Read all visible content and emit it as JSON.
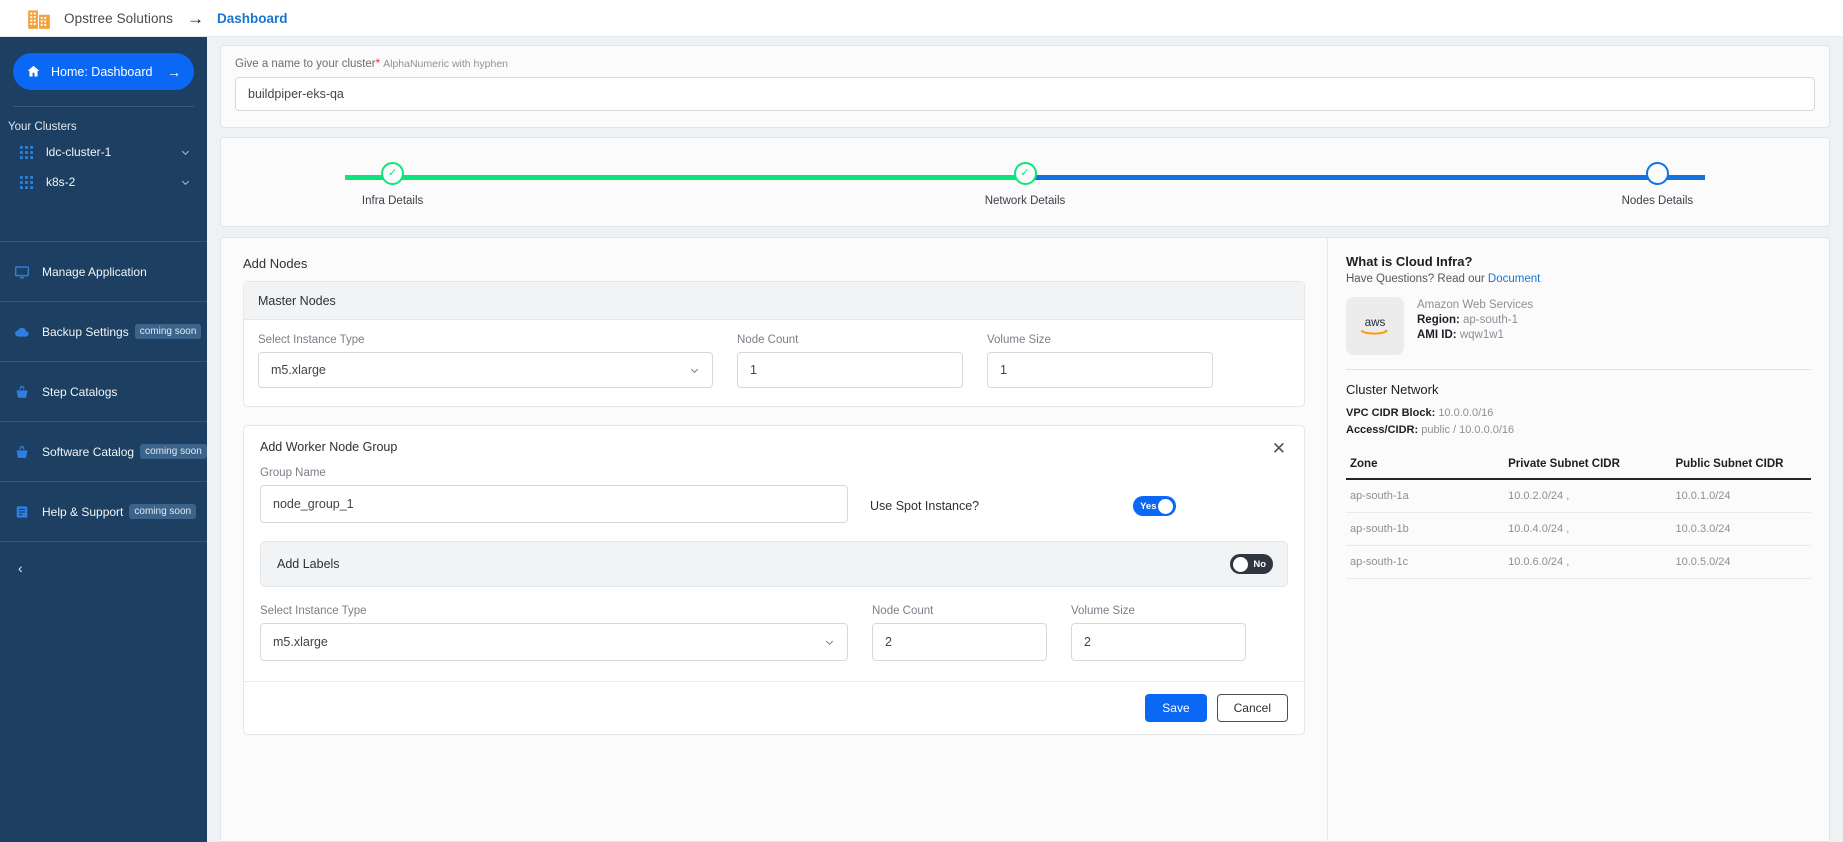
{
  "topbar": {
    "brand": "Opstree Solutions",
    "arrow": "→",
    "breadcrumb": "Dashboard"
  },
  "sidebar": {
    "home": {
      "label": "Home: Dashboard",
      "arrow": "→"
    },
    "clusters_title": "Your Clusters",
    "clusters": [
      {
        "label": "ldc-cluster-1"
      },
      {
        "label": "k8s-2"
      }
    ],
    "nav": [
      {
        "label": "Manage Application",
        "badge": "",
        "icon": "monitor-icon"
      },
      {
        "label": "Backup Settings",
        "badge": "coming soon",
        "icon": "cloud-upload-icon"
      },
      {
        "label": "Step Catalogs",
        "badge": "",
        "icon": "basket-icon"
      },
      {
        "label": "Software Catalog",
        "badge": "coming soon",
        "icon": "basket-icon"
      },
      {
        "label": "Help & Support",
        "badge": "coming soon",
        "icon": "book-icon"
      }
    ],
    "collapse": "‹"
  },
  "cluster_name": {
    "label": "Give a name to your cluster",
    "required_mark": "*",
    "hint": "AlphaNumeric with hyphen",
    "value": "buildpiper-eks-qa",
    "placeholder": "Enter cluster name"
  },
  "stepper": {
    "steps": [
      {
        "label": "Infra Details",
        "state": "done",
        "glyph": "✓"
      },
      {
        "label": "Network Details",
        "state": "done",
        "glyph": "✓"
      },
      {
        "label": "Nodes Details",
        "state": "active",
        "glyph": ""
      }
    ],
    "colors": {
      "done": "#0ae67c",
      "active": "#1273e0"
    }
  },
  "add_nodes": {
    "title": "Add Nodes",
    "master": {
      "panel_title": "Master Nodes",
      "instance_label": "Select Instance Type",
      "instance_value": "m5.xlarge",
      "node_count_label": "Node Count",
      "node_count_value": "1",
      "volume_label": "Volume Size",
      "volume_value": "1"
    },
    "worker": {
      "panel_title": "Add Worker Node Group",
      "group_name_label": "Group Name",
      "group_name_value": "node_group_1",
      "group_name_placeholder": "Enter group name",
      "spot_label": "Use Spot Instance?",
      "spot_toggle": "Yes",
      "labels_title": "Add Labels",
      "labels_toggle": "No",
      "instance_label": "Select Instance Type",
      "instance_value": "m5.xlarge",
      "node_count_label": "Node Count",
      "node_count_value": "2",
      "volume_label": "Volume Size",
      "volume_value": "2",
      "save_label": "Save",
      "cancel_label": "Cancel"
    }
  },
  "info_panel": {
    "title": "What is Cloud Infra?",
    "subtitle_text": "Have Questions? Read our ",
    "subtitle_link": "Document",
    "provider_logo": "aws",
    "provider_name": "Amazon Web Services",
    "region_key": "Region:",
    "region_value": "ap-south-1",
    "ami_key": "AMI ID:",
    "ami_value": "wqw1w1",
    "network_title": "Cluster Network",
    "vpc_key": "VPC CIDR Block:",
    "vpc_value": "10.0.0.0/16",
    "access_key": "Access/CIDR:",
    "access_value": "public / 10.0.0.0/16",
    "table": {
      "headers": [
        "Zone",
        "Private Subnet CIDR",
        "Public Subnet CIDR"
      ],
      "rows": [
        [
          "ap-south-1a",
          "10.0.2.0/24 ,",
          "10.0.1.0/24"
        ],
        [
          "ap-south-1b",
          "10.0.4.0/24 ,",
          "10.0.3.0/24"
        ],
        [
          "ap-south-1c",
          "10.0.6.0/24 ,",
          "10.0.5.0/24"
        ]
      ]
    }
  }
}
